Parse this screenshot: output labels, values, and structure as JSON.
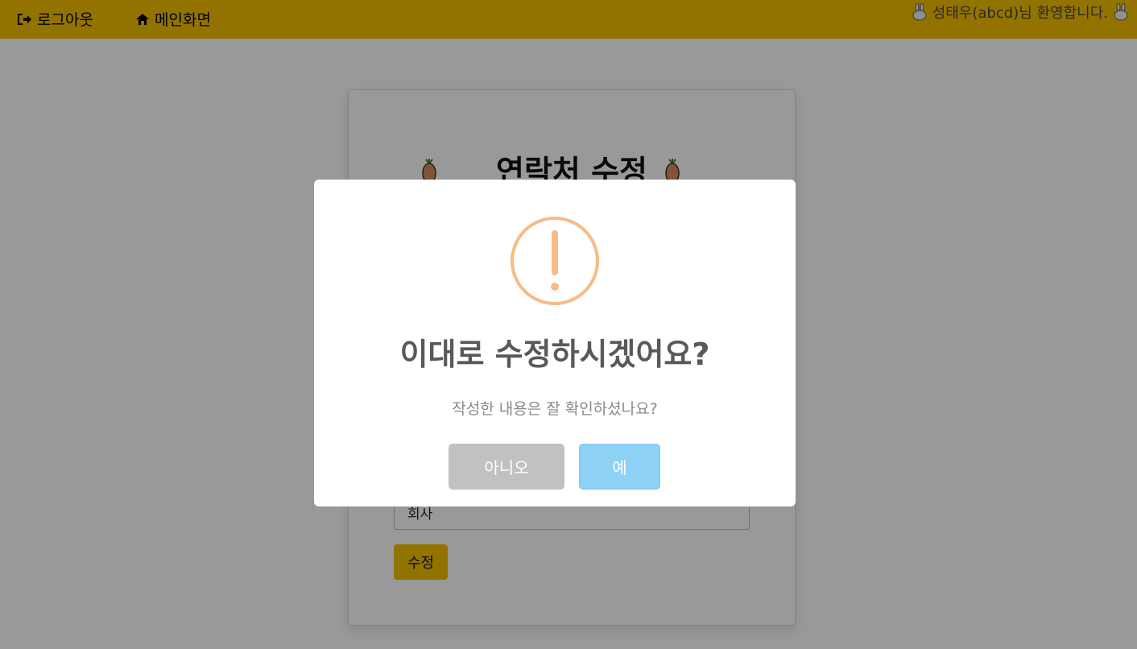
{
  "navbar": {
    "logout_label": "로그아웃",
    "home_label": "메인화면",
    "welcome_text": "성태우(abcd)님 환영합니다."
  },
  "page": {
    "title": "연락처 수정",
    "company_value": "회사",
    "submit_label": "수정"
  },
  "dialog": {
    "title": "이대로 수정하시겠어요?",
    "text": "작성한 내용은 잘 확인하셨나요?",
    "cancel_label": "아니오",
    "confirm_label": "예",
    "icon": "exclamation-warning-icon"
  },
  "colors": {
    "navbar": "#f5c000",
    "warning": "#f8bb86",
    "confirm": "#8dd2f5",
    "cancel": "#c1c1c1"
  }
}
